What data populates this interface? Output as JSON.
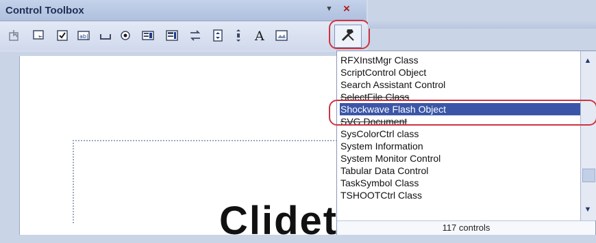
{
  "toolbox": {
    "title": "Control Toolbox",
    "close_glyph": "×",
    "icons": [
      "select-objects-icon",
      "properties-icon",
      "checkbox-icon",
      "textbox-icon",
      "command-button-icon",
      "option-button-icon",
      "listbox-icon",
      "combobox-icon",
      "toggle-button-icon",
      "spin-button-icon",
      "scrollbar-icon",
      "label-icon",
      "image-icon",
      "more-controls-icon"
    ]
  },
  "list": {
    "items": [
      "RFXInstMgr Class",
      "ScriptControl Object",
      "Search Assistant Control",
      "SelectFile Class",
      "Shockwave Flash Object",
      "SVG Document",
      "SysColorCtrl class",
      "System Information",
      "System Monitor Control",
      "Tabular Data Control",
      "TaskSymbol Class",
      "TSHOOTCtrl Class"
    ],
    "selected_index": 4,
    "footer": "117 controls"
  },
  "canvas": {
    "partial_text": "Clidet"
  },
  "colors": {
    "title_text": "#1f2e55",
    "selection": "#3b56a8",
    "highlight_ring": "#cc3340",
    "panel_bg": "#c9d4e6"
  }
}
